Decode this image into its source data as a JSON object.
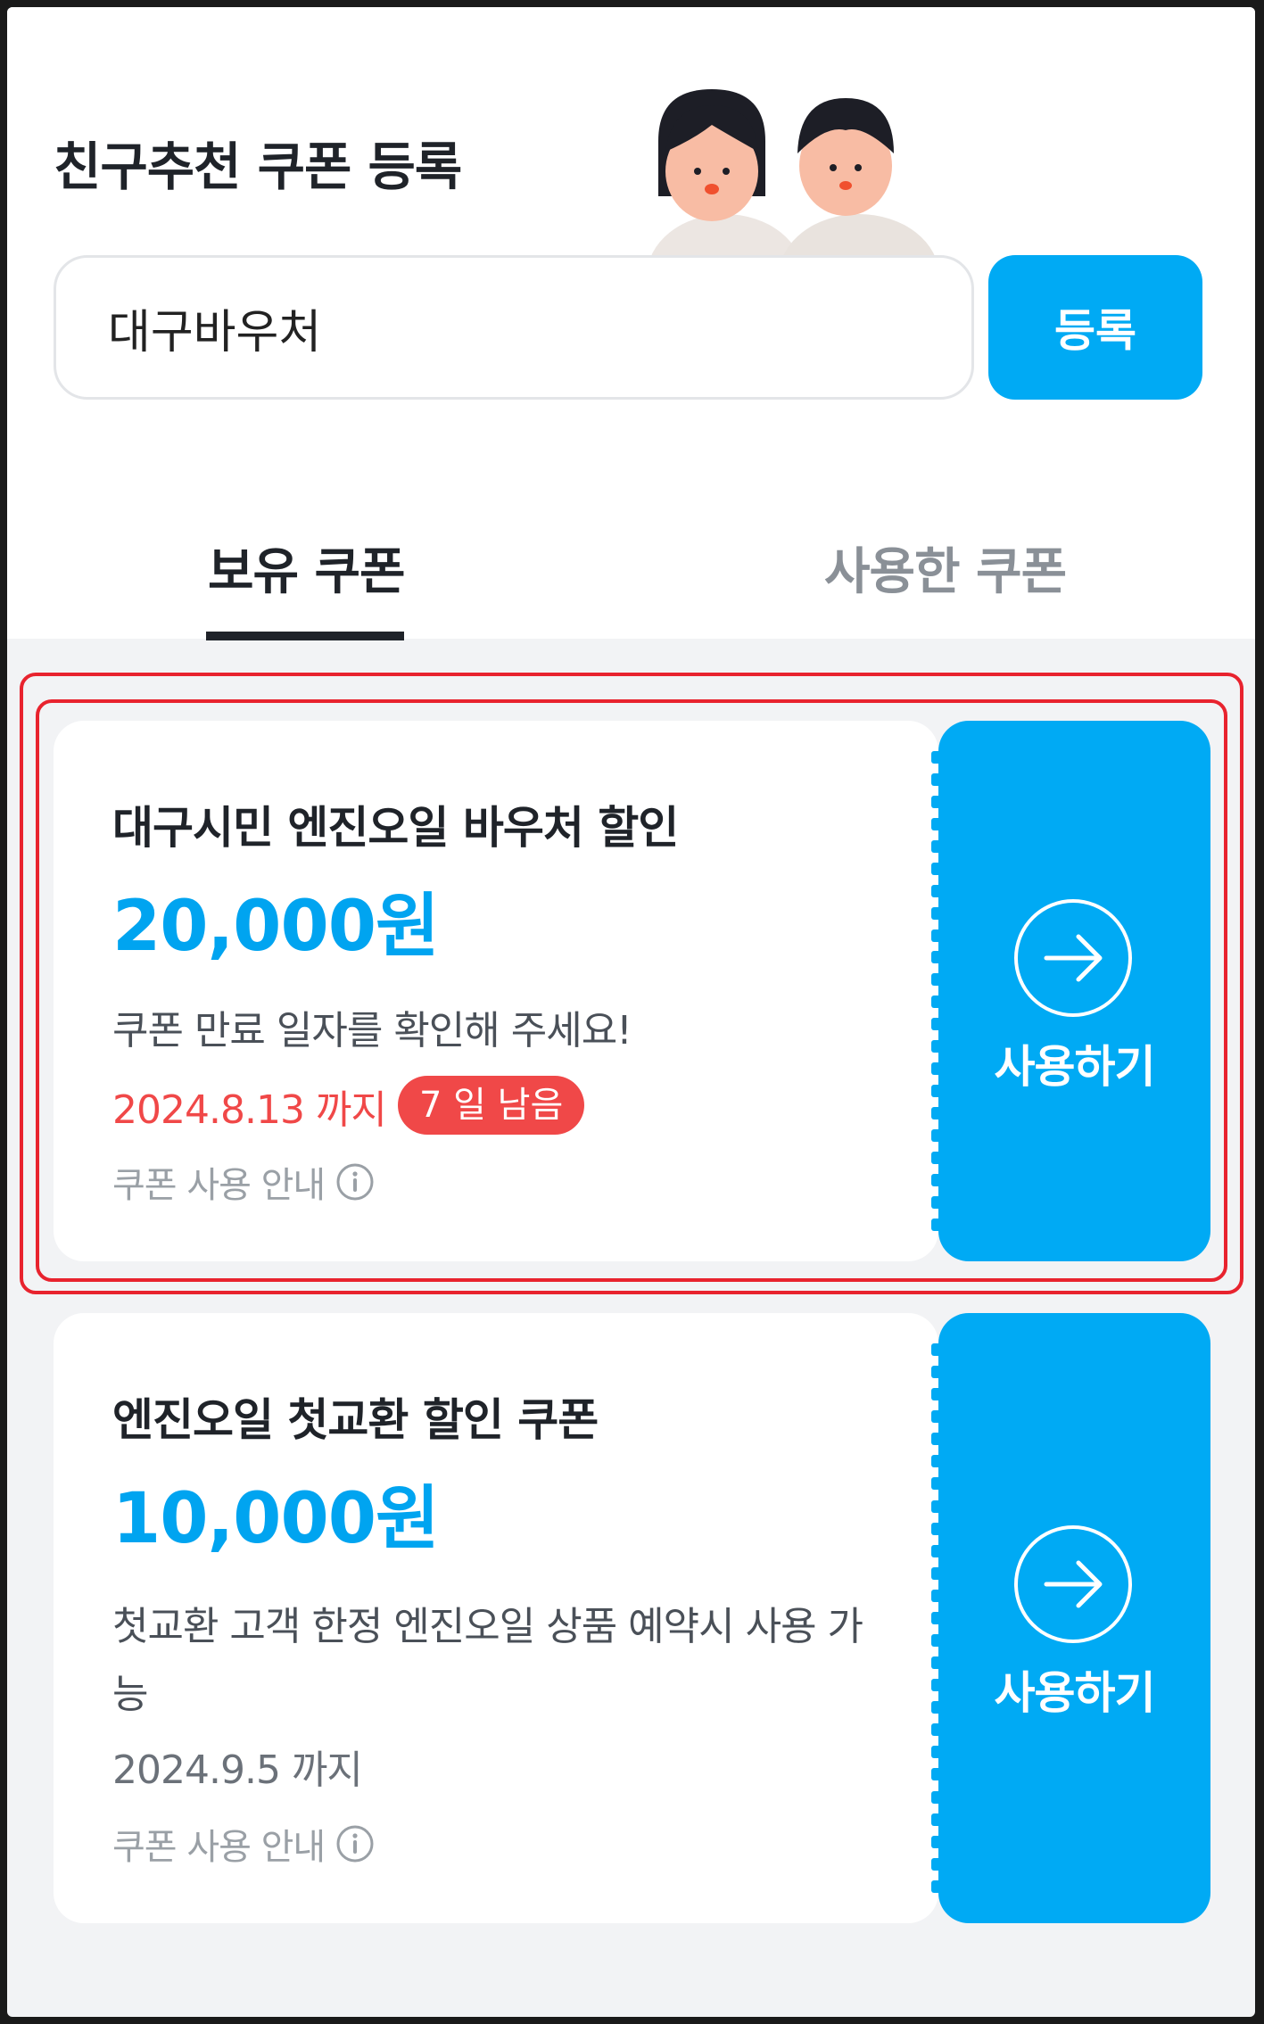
{
  "header": {
    "title": "친구추천 쿠폰 등록",
    "mascot_icon": "two-kids-mascot-icon"
  },
  "register": {
    "input_value": "대구바우처",
    "button_label": "등록"
  },
  "tabs": [
    {
      "label": "보유 쿠폰",
      "active": true
    },
    {
      "label": "사용한 쿠폰",
      "active": false
    }
  ],
  "coupons": [
    {
      "name": "대구시민 엔진오일 바우처 할인",
      "amount": "20,000원",
      "description": "쿠폰 만료 일자를 확인해 주세요!",
      "expiry": "2024.8.13 까지",
      "expiry_color": "#f04848",
      "days_left_badge": "7 일 남음",
      "guide_label": "쿠폰 사용 안내",
      "action_label": "사용하기",
      "highlighted": true
    },
    {
      "name": "엔진오일 첫교환 할인 쿠폰",
      "amount": "10,000원",
      "description": "첫교환 고객 한정 엔진오일 상품 예약시 사용 가능",
      "expiry": "2024.9.5 까지",
      "expiry_color": "#6b7179",
      "guide_label": "쿠폰 사용 안내",
      "action_label": "사용하기",
      "highlighted": false
    }
  ],
  "colors": {
    "accent": "#00aaf4",
    "amount": "#00a4f0",
    "warning": "#f04848",
    "highlight_box": "#e8232e",
    "background": "#f2f3f5"
  }
}
